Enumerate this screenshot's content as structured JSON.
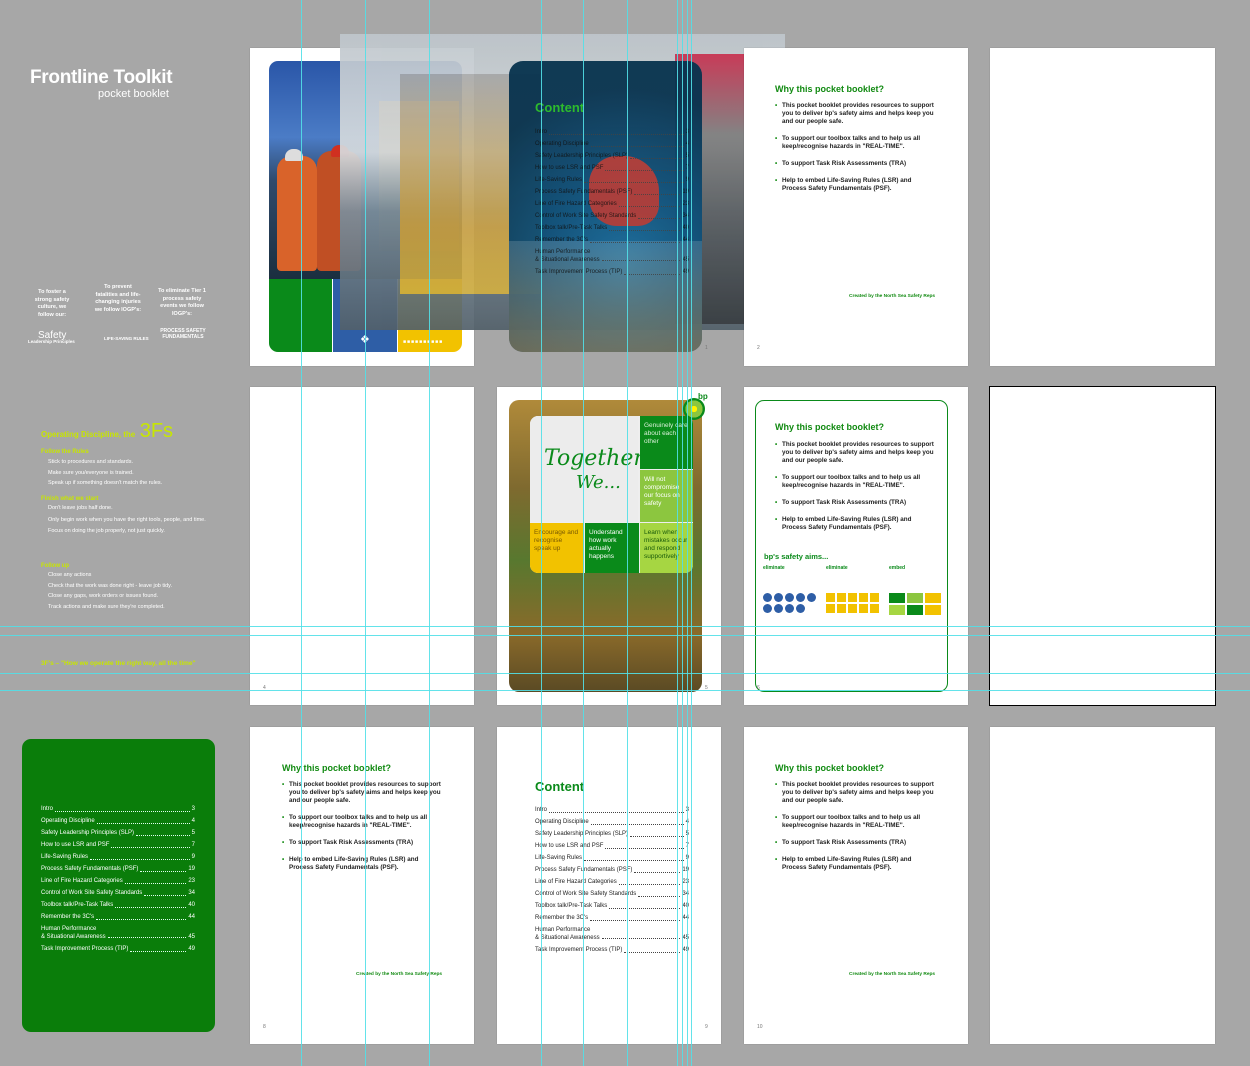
{
  "cover": {
    "title": "Frontline Toolkit",
    "subtitle": "pocket booklet",
    "col1": "To foster a strong safety culture, we follow our:",
    "col2": "To prevent fatalities and life-changing injuries we follow IOGP's:",
    "col3": "To eliminate Tier 1 process safety events we follow IOGP's:",
    "logo1_big": "Safety",
    "logo1_small": "Leadership Principles",
    "logo2": "LIFE-SAVING RULES",
    "logo3": "PROCESS SAFETY FUNDAMENTALS"
  },
  "ops": {
    "title_pre": "Operating Discipline, the",
    "title_big": "3Fs",
    "sections": [
      {
        "head": "Follow the Rules",
        "items": [
          "Stick to procedures and standards.",
          "Make sure you/everyone is trained.",
          "Speak up if something doesn't match the rules."
        ]
      },
      {
        "head": "Finish what we start",
        "items": [
          "Don't leave jobs half done.",
          "Only begin work when you have the right tools, people, and time.",
          "Focus on doing the job properly, not just quickly."
        ]
      },
      {
        "head": "Follow up",
        "items": [
          "Close any actions",
          "Check that the work was done right - leave job tidy.",
          "Close any gaps, work orders or issues found.",
          "Track actions and make sure they're completed."
        ]
      }
    ],
    "footer": "3F's – \"How we operate the right way, all the time\""
  },
  "why": {
    "title": "Why this pocket booklet?",
    "bullets": [
      "This pocket booklet provides resources to support you to deliver bp's safety aims and helps keep you and our people safe.",
      "To support our toolbox talks and to help us all keep/recognise hazards in \"REAL-TIME\".",
      "To support Task Risk Assessments (TRA)",
      "Help to embed Life-Saving Rules (LSR) and Process Safety Fundamentals (PSF)."
    ],
    "credit": "Created by the North Sea Safety Reps"
  },
  "aims": {
    "title": "bp's safety aims...",
    "cols": [
      "eliminate",
      "eliminate",
      "embed"
    ]
  },
  "content": {
    "title": "Content",
    "rows": [
      {
        "label": "Intro",
        "page": "3"
      },
      {
        "label": "Operating Discipline",
        "page": "4"
      },
      {
        "label": "Safety Leadership Principles (SLP)",
        "page": "5"
      },
      {
        "label": "How to use LSR and PSF",
        "page": "7"
      },
      {
        "label": "Life-Saving Rules",
        "page": "9"
      },
      {
        "label": "Process Safety Fundamentals (PSF)",
        "page": "19"
      },
      {
        "label": "Line of Fire Hazard Categories",
        "page": "23"
      },
      {
        "label": "Control of Work Site Safety Standards",
        "page": "34"
      },
      {
        "label": "Toolbox talk/Pre-Task Talks",
        "page": "40"
      },
      {
        "label": "Remember the 3C's",
        "page": "44"
      },
      {
        "label": "Human Performance\n& Situational Awareness",
        "page": "45"
      },
      {
        "label": "Task Improvement Process (TIP)",
        "page": "49"
      }
    ]
  },
  "together": {
    "title_1": "Together,",
    "title_2": "We...",
    "tiles": [
      "Genuinely care about each other",
      "Will not compromise our focus on safety",
      "Encourage and recognise speak up",
      "Understand how work actually happens",
      "Learn when mistakes occur and respond supportively"
    ],
    "brand": "bp"
  },
  "page_numbers": [
    "1",
    "2",
    "4",
    "5",
    "6",
    "8",
    "9",
    "10"
  ],
  "colors": {
    "bp_green": "#008000",
    "bp_blue": "#2e5ea6",
    "bp_yellow": "#f2c200",
    "bp_lime": "#c7e600",
    "canvas": "#a7a7a7"
  }
}
